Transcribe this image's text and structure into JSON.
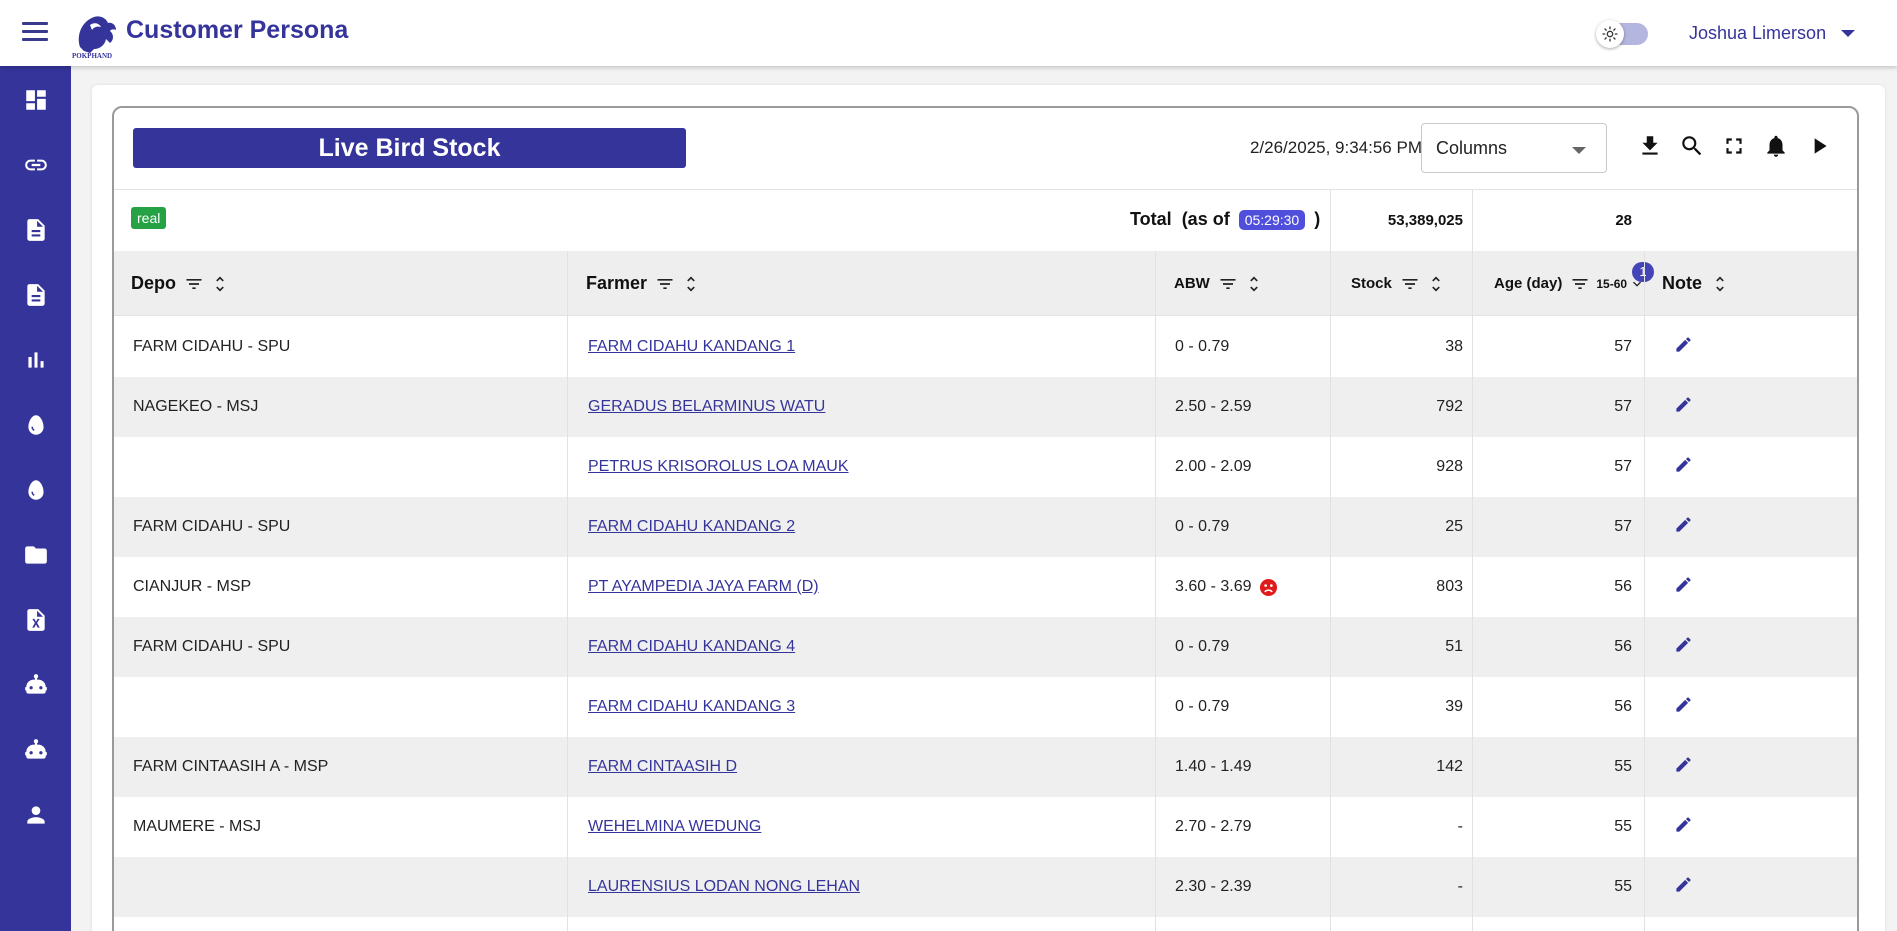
{
  "app": {
    "title": "Customer Persona"
  },
  "user": {
    "name": "Joshua Limerson"
  },
  "sidebar": {
    "items": [
      {
        "icon": "dashboard-icon"
      },
      {
        "icon": "link-icon"
      },
      {
        "icon": "document-icon"
      },
      {
        "icon": "document-icon"
      },
      {
        "icon": "bar-chart-icon"
      },
      {
        "icon": "egg-icon"
      },
      {
        "icon": "egg-icon"
      },
      {
        "icon": "folder-icon"
      },
      {
        "icon": "excel-file-icon"
      },
      {
        "icon": "robot-icon"
      },
      {
        "icon": "robot-icon"
      },
      {
        "icon": "person-icon"
      }
    ]
  },
  "panel": {
    "title": "Live Bird Stock",
    "timestamp": "2/26/2025, 9:34:56 PM",
    "columns_select": "Columns",
    "badge": "real",
    "total": {
      "label": "Total",
      "as_of_label": "(as of",
      "as_of_time": "05:29:30",
      "close_paren": ")",
      "stock": "53,389,025",
      "age": "28"
    }
  },
  "table": {
    "headers": {
      "depo": "Depo",
      "farmer": "Farmer",
      "abw": "ABW",
      "stock": "Stock",
      "age": "Age (day)",
      "age_filter": "15-60",
      "note": "Note"
    },
    "active_filter_count": "1",
    "rows": [
      {
        "depo": "FARM CIDAHU - SPU",
        "farmer": "FARM CIDAHU KANDANG 1",
        "abw": "0 - 0.79",
        "stock": "38",
        "age": "57",
        "warn": false
      },
      {
        "depo": "NAGEKEO - MSJ",
        "farmer": "GERADUS BELARMINUS WATU",
        "abw": "2.50 - 2.59",
        "stock": "792",
        "age": "57",
        "warn": false
      },
      {
        "depo": "",
        "farmer": "PETRUS KRISOROLUS LOA MAUK",
        "abw": "2.00 - 2.09",
        "stock": "928",
        "age": "57",
        "warn": false
      },
      {
        "depo": "FARM CIDAHU - SPU",
        "farmer": "FARM CIDAHU KANDANG 2",
        "abw": "0 - 0.79",
        "stock": "25",
        "age": "57",
        "warn": false
      },
      {
        "depo": "CIANJUR - MSP",
        "farmer": "PT AYAMPEDIA JAYA FARM (D)",
        "abw": "3.60 - 3.69",
        "stock": "803",
        "age": "56",
        "warn": true
      },
      {
        "depo": "FARM CIDAHU - SPU",
        "farmer": "FARM CIDAHU KANDANG 4",
        "abw": "0 - 0.79",
        "stock": "51",
        "age": "56",
        "warn": false
      },
      {
        "depo": "",
        "farmer": "FARM CIDAHU KANDANG 3",
        "abw": "0 - 0.79",
        "stock": "39",
        "age": "56",
        "warn": false
      },
      {
        "depo": "FARM CINTAASIH A - MSP",
        "farmer": "FARM CINTAASIH D",
        "abw": "1.40 - 1.49",
        "stock": "142",
        "age": "55",
        "warn": false
      },
      {
        "depo": "MAUMERE - MSJ",
        "farmer": "WEHELMINA WEDUNG",
        "abw": "2.70 - 2.79",
        "stock": "-",
        "age": "55",
        "warn": false
      },
      {
        "depo": "",
        "farmer": "LAURENSIUS LODAN NONG LEHAN",
        "abw": "2.30 - 2.39",
        "stock": "-",
        "age": "55",
        "warn": false
      }
    ]
  },
  "colors": {
    "primary": "#35349a",
    "badge_green": "#25a244",
    "chip_blue": "#4f4fdc",
    "warn_red": "#e01b1b"
  }
}
